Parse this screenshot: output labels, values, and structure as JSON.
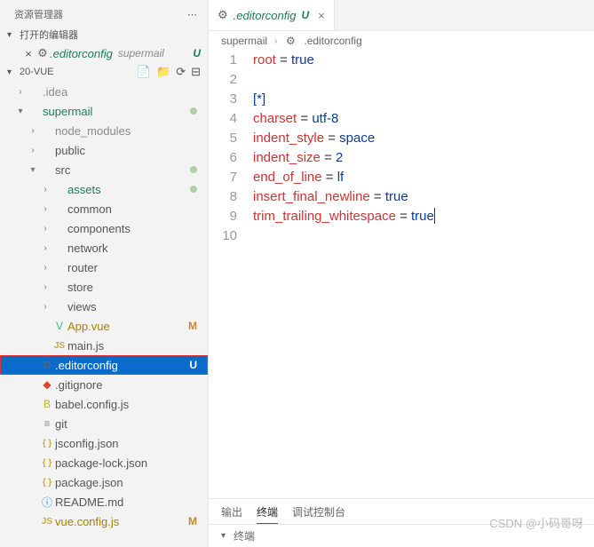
{
  "sidebar": {
    "title": "资源管理器",
    "open_editors_label": "打开的编辑器",
    "open_editor": {
      "filename": ".editorconfig",
      "dir": "supermail",
      "badge": "U"
    },
    "project_label": "20-VUE",
    "tree": [
      {
        "id": 0,
        "indent": 1,
        "kind": "folder",
        "open": false,
        "label": ".idea",
        "cls": "folder-grey"
      },
      {
        "id": 1,
        "indent": 1,
        "kind": "folder",
        "open": true,
        "label": "supermail",
        "cls": "folder-green",
        "dot": true
      },
      {
        "id": 2,
        "indent": 2,
        "kind": "folder",
        "open": false,
        "label": "node_modules",
        "cls": "folder-grey"
      },
      {
        "id": 3,
        "indent": 2,
        "kind": "folder",
        "open": false,
        "label": "public"
      },
      {
        "id": 4,
        "indent": 2,
        "kind": "folder",
        "open": true,
        "label": "src",
        "dot": true
      },
      {
        "id": 5,
        "indent": 3,
        "kind": "folder",
        "open": false,
        "label": "assets",
        "cls": "folder-green",
        "dot": true
      },
      {
        "id": 6,
        "indent": 3,
        "kind": "folder",
        "open": false,
        "label": "common"
      },
      {
        "id": 7,
        "indent": 3,
        "kind": "folder",
        "open": false,
        "label": "components"
      },
      {
        "id": 8,
        "indent": 3,
        "kind": "folder",
        "open": false,
        "label": "network"
      },
      {
        "id": 9,
        "indent": 3,
        "kind": "folder",
        "open": false,
        "label": "router"
      },
      {
        "id": 10,
        "indent": 3,
        "kind": "folder",
        "open": false,
        "label": "store"
      },
      {
        "id": 11,
        "indent": 3,
        "kind": "folder",
        "open": false,
        "label": "views"
      },
      {
        "id": 12,
        "indent": 3,
        "kind": "file",
        "icon": "vue",
        "label": "App.vue",
        "cls": "file-yellow",
        "badge": "M"
      },
      {
        "id": 13,
        "indent": 3,
        "kind": "file",
        "icon": "js",
        "label": "main.js"
      },
      {
        "id": 14,
        "indent": 2,
        "kind": "file",
        "icon": "gear",
        "label": ".editorconfig",
        "cls": "file-green",
        "badge": "U",
        "selected": true
      },
      {
        "id": 15,
        "indent": 2,
        "kind": "file",
        "icon": "git",
        "label": ".gitignore"
      },
      {
        "id": 16,
        "indent": 2,
        "kind": "file",
        "icon": "babel",
        "label": "babel.config.js"
      },
      {
        "id": 17,
        "indent": 2,
        "kind": "file",
        "icon": "lines",
        "label": "git"
      },
      {
        "id": 18,
        "indent": 2,
        "kind": "file",
        "icon": "json",
        "label": "jsconfig.json"
      },
      {
        "id": 19,
        "indent": 2,
        "kind": "file",
        "icon": "json",
        "label": "package-lock.json"
      },
      {
        "id": 20,
        "indent": 2,
        "kind": "file",
        "icon": "json",
        "label": "package.json"
      },
      {
        "id": 21,
        "indent": 2,
        "kind": "file",
        "icon": "info",
        "label": "README.md"
      },
      {
        "id": 22,
        "indent": 2,
        "kind": "file",
        "icon": "js",
        "label": "vue.config.js",
        "cls": "file-yellow",
        "badge": "M"
      }
    ]
  },
  "tab": {
    "filename": ".editorconfig",
    "badge": "U"
  },
  "breadcrumb": {
    "dir": "supermail",
    "file": ".editorconfig"
  },
  "editor": {
    "lines": [
      {
        "n": 1,
        "key": "root",
        "op": "=",
        "val": "true"
      },
      {
        "n": 2,
        "blank": true
      },
      {
        "n": 3,
        "section": "[*]"
      },
      {
        "n": 4,
        "key": "charset",
        "op": "=",
        "val": "utf-8"
      },
      {
        "n": 5,
        "key": "indent_style",
        "op": "=",
        "val": "space"
      },
      {
        "n": 6,
        "key": "indent_size",
        "op": "=",
        "val": "2"
      },
      {
        "n": 7,
        "key": "end_of_line",
        "op": "=",
        "val": "lf"
      },
      {
        "n": 8,
        "key": "insert_final_newline",
        "op": "=",
        "val": "true"
      },
      {
        "n": 9,
        "key": "trim_trailing_whitespace",
        "op": "=",
        "val": "true"
      },
      {
        "n": 10,
        "blank": true
      }
    ]
  },
  "panel": {
    "tabs": [
      "输出",
      "终端",
      "调试控制台"
    ],
    "active": 1,
    "terminal_label": "终端"
  },
  "watermark": "CSDN @小码哥呀",
  "icons": {
    "gear": "⚙",
    "vue": "V",
    "js": "JS",
    "git": "◆",
    "babel": "B",
    "lines": "≡",
    "json": "{ }",
    "info": "ⓘ",
    "ellipsis": "⋯",
    "newfile": "📄",
    "newfolder": "📁",
    "refresh": "⟳",
    "collapse": "⊟"
  }
}
